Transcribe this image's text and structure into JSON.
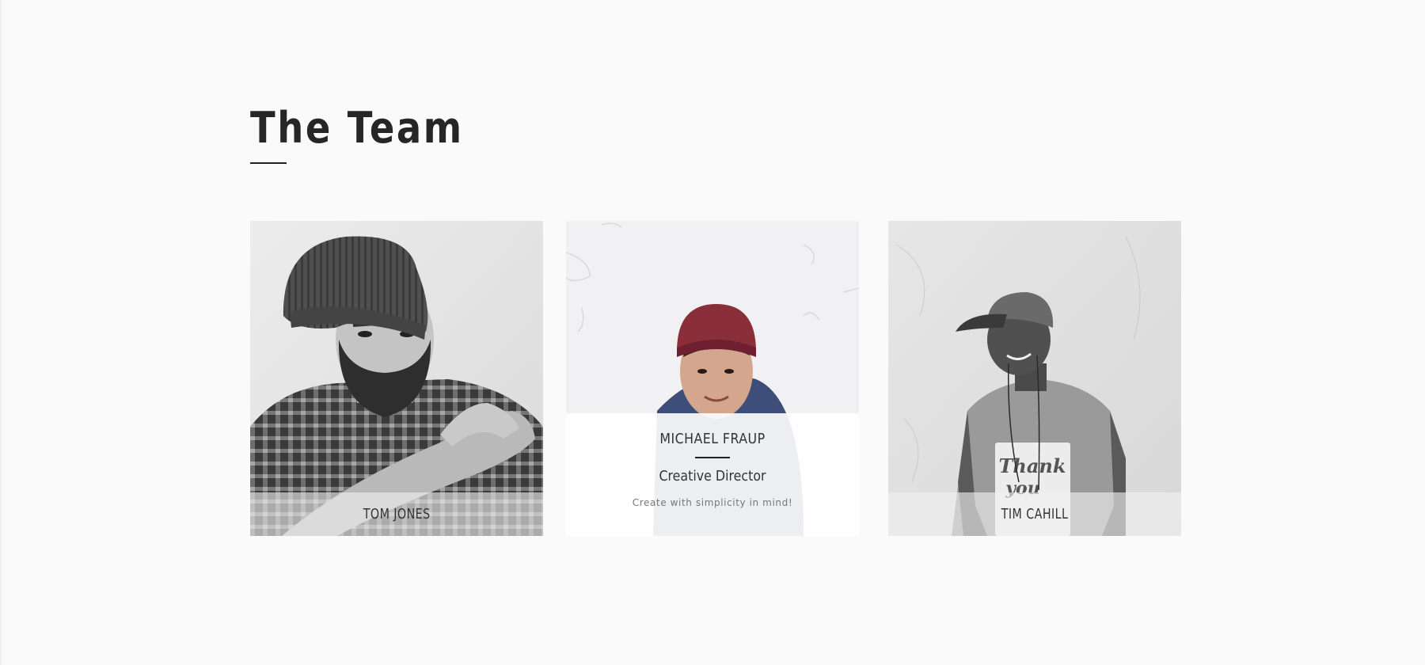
{
  "section": {
    "title": "The Team"
  },
  "team": [
    {
      "name": "TOM JONES"
    },
    {
      "name": "MICHAEL FRAUP",
      "role": "Creative Director",
      "tagline": "Create with simplicity in mind!"
    },
    {
      "name": "TIM CAHILL"
    }
  ]
}
